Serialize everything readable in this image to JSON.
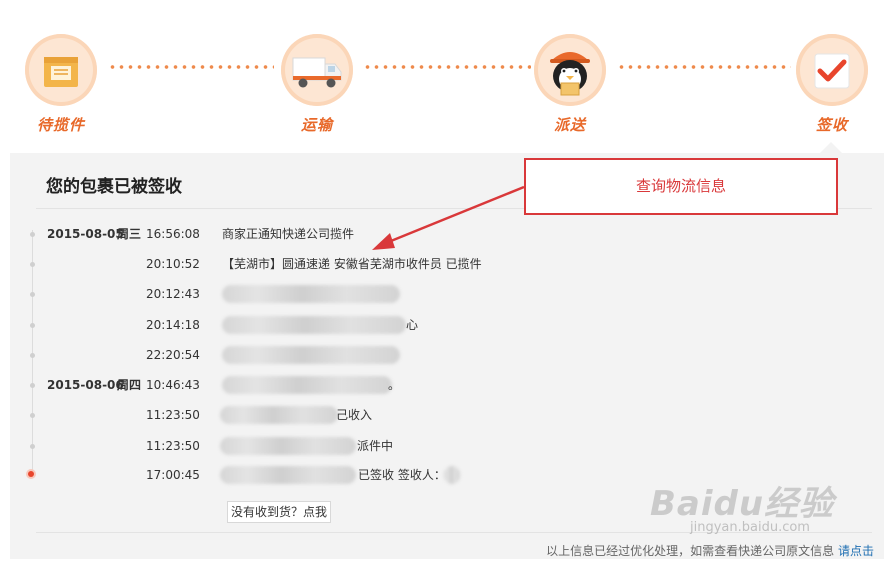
{
  "steps": [
    {
      "label": "待揽件",
      "icon": "pending-package-icon"
    },
    {
      "label": "运输",
      "icon": "truck-icon"
    },
    {
      "label": "派送",
      "icon": "courier-penguin-icon"
    },
    {
      "label": "签收",
      "icon": "checkmark-signed-icon"
    }
  ],
  "panel": {
    "title": "您的包裹已被签收",
    "annotation": "查询物流信息",
    "not_received": "没有收到货？点我",
    "footer_text": "以上信息已经过优化处理，如需查看快递公司原文信息",
    "footer_link": "请点击"
  },
  "timeline": [
    {
      "date": "2015-08-05",
      "weekday": "周三",
      "time": "16:56:08",
      "desc": "商家正通知快递公司揽件",
      "tail": ""
    },
    {
      "date": "",
      "weekday": "",
      "time": "20:10:52",
      "desc": "【芜湖市】圆通速递 安徽省芜湖市收件员 已揽件",
      "tail": ""
    },
    {
      "date": "",
      "weekday": "",
      "time": "20:12:43",
      "desc": "",
      "tail": ""
    },
    {
      "date": "",
      "weekday": "",
      "time": "20:14:18",
      "desc": "",
      "tail": "心"
    },
    {
      "date": "",
      "weekday": "",
      "time": "22:20:54",
      "desc": "",
      "tail": ""
    },
    {
      "date": "2015-08-06",
      "weekday": "周四",
      "time": "10:46:43",
      "desc": "",
      "tail": "。"
    },
    {
      "date": "",
      "weekday": "",
      "time": "11:23:50",
      "desc": "",
      "tail": "己收入"
    },
    {
      "date": "",
      "weekday": "",
      "time": "11:23:50",
      "desc": "",
      "tail": "派件中"
    },
    {
      "date": "",
      "weekday": "",
      "time": "17:00:45",
      "desc": "",
      "tail": "已签收 签收人："
    }
  ],
  "watermark": {
    "logo": "Baidu经验",
    "url": "jingyan.baidu.com"
  },
  "colors": {
    "accent": "#e8692a",
    "annotation": "#d9383a",
    "link": "#1f6fb2",
    "panel_bg": "#f3f3f3"
  }
}
